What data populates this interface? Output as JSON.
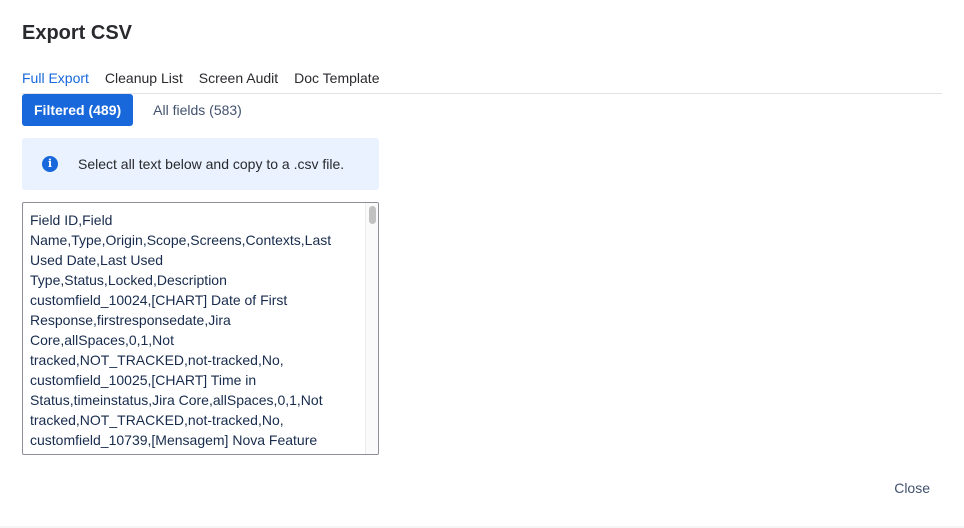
{
  "dialog": {
    "title": "Export CSV",
    "tabs": [
      {
        "label": "Full Export",
        "active": true
      },
      {
        "label": "Cleanup List",
        "active": false
      },
      {
        "label": "Screen Audit",
        "active": false
      },
      {
        "label": "Doc Template",
        "active": false
      }
    ],
    "segments": [
      {
        "label": "Filtered (489)",
        "active": true
      },
      {
        "label": "All fields (583)",
        "active": false
      }
    ],
    "info": {
      "icon": "info-icon",
      "text": "Select all text below and copy to a .csv file."
    },
    "csv_text": "Field ID,Field Name,Type,Origin,Scope,Screens,Contexts,Last Used Date,Last Used Type,Status,Locked,Description\ncustomfield_10024,[CHART] Date of First Response,firstresponsedate,Jira Core,allSpaces,0,1,Not tracked,NOT_TRACKED,not-tracked,No,\ncustomfield_10025,[CHART] Time in Status,timeinstatus,Jira Core,allSpaces,0,1,Not tracked,NOT_TRACKED,not-tracked,No,\ncustomfield_10739,[Mensagem] Nova Feature",
    "close_label": "Close"
  },
  "colors": {
    "accent": "#1868db",
    "info_bg": "#e9f2fe",
    "text": "#292a2e"
  }
}
